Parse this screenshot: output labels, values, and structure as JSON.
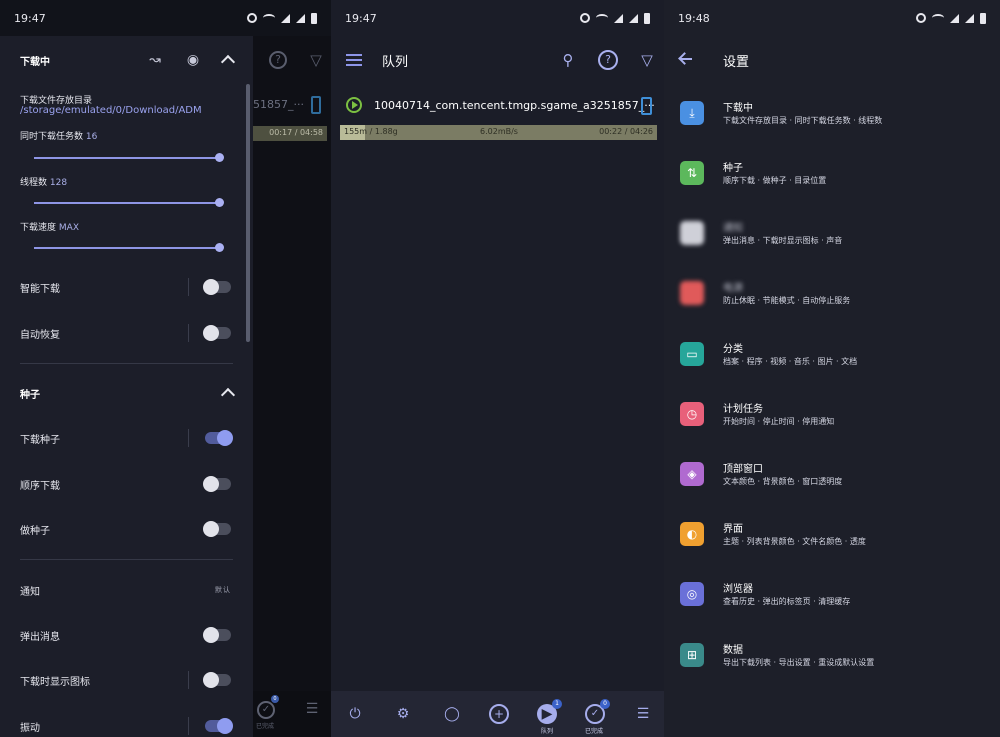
{
  "panel1": {
    "status": {
      "time": "19:47"
    },
    "background": {
      "file_fragment": "51857_···",
      "progress_text": "00:17 / 04:58",
      "nav_label": "已完成",
      "nav_badge": "0"
    },
    "drawer": {
      "download_section": {
        "title": "下载中"
      },
      "storage_label": "下载文件存放目录",
      "storage_path": "/storage/emulated/0/Download/ADM",
      "concurrent": {
        "label": "同时下载任务数",
        "value": "16",
        "level": 1.0
      },
      "threads": {
        "label": "线程数",
        "value": "128",
        "level": 1.0
      },
      "speed": {
        "label": "下载速度",
        "value": "MAX",
        "level": 1.0
      },
      "toggles1": [
        {
          "label": "智能下载",
          "on": false
        },
        {
          "label": "自动恢复",
          "on": false
        }
      ],
      "torrent_section": {
        "title": "种子"
      },
      "toggles2": [
        {
          "label": "下载种子",
          "on": true
        },
        {
          "label": "顺序下载",
          "on": false
        },
        {
          "label": "做种子",
          "on": false
        }
      ],
      "notify": {
        "label": "通知",
        "tag": "默认"
      },
      "toggles3": [
        {
          "label": "弹出消息",
          "on": false
        },
        {
          "label": "下载时显示图标",
          "on": false
        },
        {
          "label": "振动",
          "on": true
        }
      ]
    }
  },
  "panel2": {
    "status": {
      "time": "19:47"
    },
    "title": "队列",
    "queue": {
      "filename": "10040714_com.tencent.tmgp.sgame_a3251857_···",
      "size": "155m / 1.88g",
      "speed": "6.02mB/s",
      "time": "00:22 / 04:26",
      "progress": 0.08
    },
    "nav": {
      "queue_label": "队列",
      "done_label": "已完成",
      "queue_badge": "1",
      "done_badge": "0"
    }
  },
  "panel3": {
    "status": {
      "time": "19:48"
    },
    "title": "设置",
    "items": [
      {
        "title": "下载中",
        "sub": "下载文件存放目录 · 同时下载任务数 · 线程数",
        "color": "#4a90e2",
        "icon": "download-icon",
        "glyph": "⤓"
      },
      {
        "title": "种子",
        "sub": "顺序下载 · 做种子 · 目录位置",
        "color": "#5cb85c",
        "icon": "transfer-icon",
        "glyph": "⇅"
      },
      {
        "title": "通知",
        "sub": "弹出消息 · 下载时显示图标 · 声音",
        "color": "#cfd0d8",
        "icon": "blurred-icon",
        "glyph": "",
        "blurred": true
      },
      {
        "title": "电源",
        "sub": "防止休眠 · 节能模式 · 自动停止服务",
        "color": "#e05a5a",
        "icon": "blurred-icon",
        "glyph": "",
        "blurred": true
      },
      {
        "title": "分类",
        "sub": "档案 · 程序 · 视频 · 音乐 · 图片 · 文档",
        "color": "#26a69a",
        "icon": "folder-icon",
        "glyph": "▭"
      },
      {
        "title": "计划任务",
        "sub": "开始时间 · 停止时间 · 停用通知",
        "color": "#e8607a",
        "icon": "clock-icon",
        "glyph": "◷"
      },
      {
        "title": "顶部窗口",
        "sub": "文本颜色 · 背景颜色 · 窗口透明度",
        "color": "#b06ad0",
        "icon": "layers-icon",
        "glyph": "◈"
      },
      {
        "title": "界面",
        "sub": "主题 · 列表背景颜色 · 文件名颜色 · 透度",
        "color": "#f0a030",
        "icon": "theme-icon",
        "glyph": "◐"
      },
      {
        "title": "浏览器",
        "sub": "查看历史 · 弹出的标签页 · 清理缓存",
        "color": "#6a70d8",
        "icon": "globe-icon",
        "glyph": "◎"
      },
      {
        "title": "数据",
        "sub": "导出下载列表 · 导出设置 · 重设成默认设置",
        "color": "#3a8a8a",
        "icon": "import-icon",
        "glyph": "⊞"
      }
    ]
  }
}
